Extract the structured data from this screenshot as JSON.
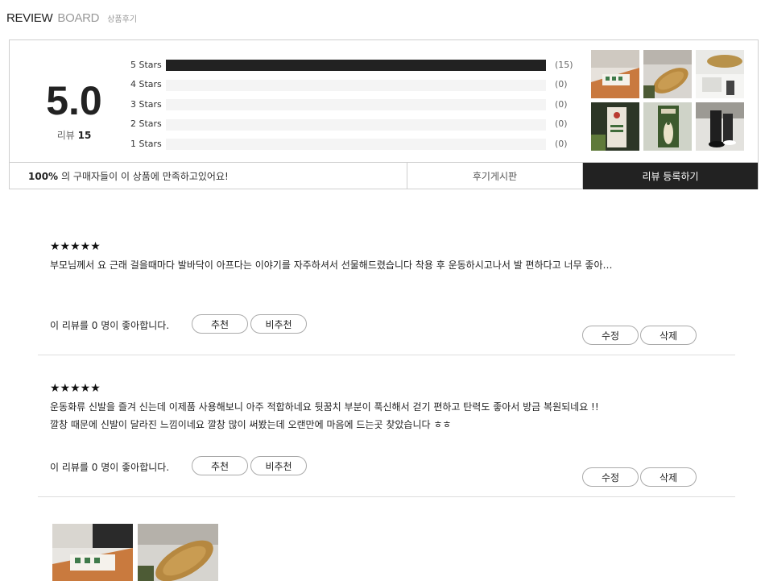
{
  "header": {
    "title_1": "REVIEW",
    "title_2": "BOARD",
    "subtitle": "상품후기"
  },
  "summary": {
    "score": "5.0",
    "review_label": "리뷰",
    "review_count": "15",
    "ratings": [
      {
        "label": "5 Stars",
        "count": "(15)",
        "fraction": 1.0
      },
      {
        "label": "4 Stars",
        "count": "(0)",
        "fraction": 0
      },
      {
        "label": "3 Stars",
        "count": "(0)",
        "fraction": 0
      },
      {
        "label": "2 Stars",
        "count": "(0)",
        "fraction": 0
      },
      {
        "label": "1 Stars",
        "count": "(0)",
        "fraction": 0
      }
    ],
    "satisfaction_percent": "100%",
    "satisfaction_text": "의 구매자들이 이 상품에 만족하고있어요!",
    "board_button": "후기게시판",
    "write_button": "리뷰 등록하기"
  },
  "reviews": [
    {
      "stars": "★★★★★",
      "lines": [
        "부모님께서 요 근래 걸을때마다 발바닥이 아프다는 이야기를 자주하셔서 선물해드렸습니다 착용 후 운동하시고나서 발 편하다고 너무 좋아…"
      ],
      "likes": "이 리뷰를 0 명이 좋아합니다.",
      "recommend": "추천",
      "not_recommend": "비추천",
      "edit": "수정",
      "delete": "삭제"
    },
    {
      "stars": "★★★★★",
      "lines": [
        "운동화류 신발을 즐겨 신는데 이제품 사용해보니 아주 적합하네요 뒷꿈치 부분이 푹신해서 걷기 편하고 탄력도 좋아서 방금 복원되네요 !!",
        "깔창 때문에 신발이 달라진 느낌이네요 깔창 많이 써봤는데 오랜만에 마음에 드는곳 찾았습니다 ㅎㅎ"
      ],
      "likes": "이 리뷰를 0 명이 좋아합니다.",
      "recommend": "추천",
      "not_recommend": "비추천",
      "edit": "수정",
      "delete": "삭제"
    }
  ]
}
